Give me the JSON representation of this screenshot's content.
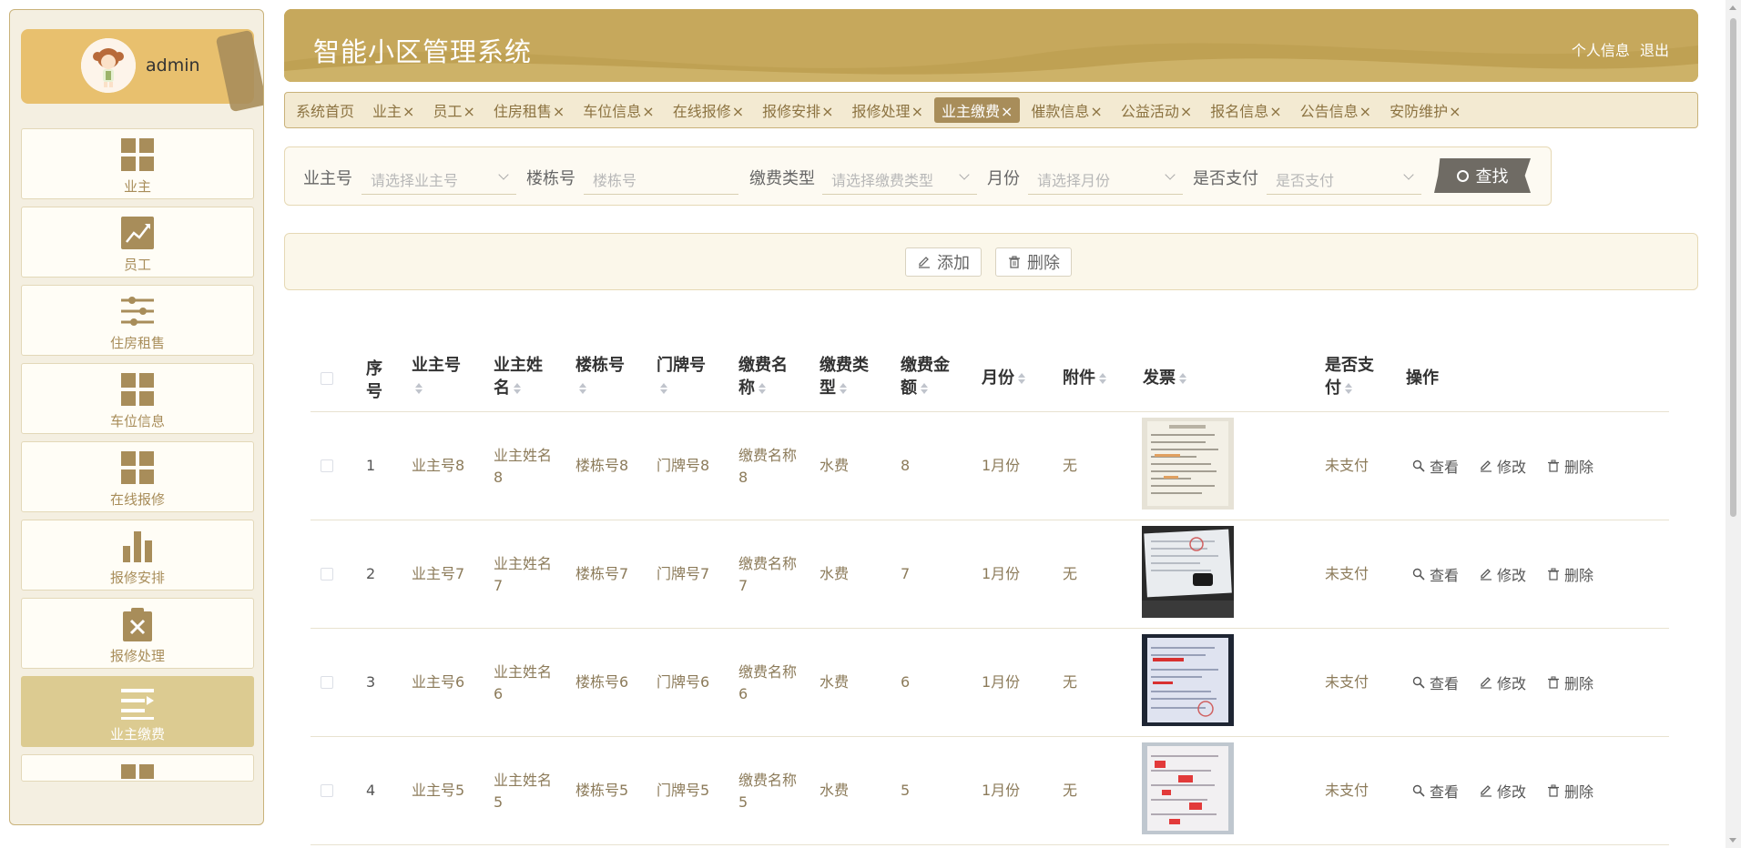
{
  "user": {
    "name": "admin"
  },
  "sidebar": {
    "items": [
      {
        "label": "业主",
        "icon": "grid-icon"
      },
      {
        "label": "员工",
        "icon": "trend-chart-icon"
      },
      {
        "label": "住房租售",
        "icon": "sliders-icon"
      },
      {
        "label": "车位信息",
        "icon": "grid-icon"
      },
      {
        "label": "在线报修",
        "icon": "grid-icon"
      },
      {
        "label": "报修安排",
        "icon": "bar-chart-icon"
      },
      {
        "label": "报修处理",
        "icon": "clipboard-x-icon"
      },
      {
        "label": "业主缴费",
        "icon": "list-arrow-icon",
        "active": true
      }
    ]
  },
  "header": {
    "title": "智能小区管理系统",
    "profile_link": "个人信息",
    "logout_link": "退出"
  },
  "tabs": [
    {
      "label": "系统首页",
      "closable": false
    },
    {
      "label": "业主",
      "closable": true
    },
    {
      "label": "员工",
      "closable": true
    },
    {
      "label": "住房租售",
      "closable": true
    },
    {
      "label": "车位信息",
      "closable": true
    },
    {
      "label": "在线报修",
      "closable": true
    },
    {
      "label": "报修安排",
      "closable": true
    },
    {
      "label": "报修处理",
      "closable": true
    },
    {
      "label": "业主缴费",
      "closable": true,
      "active": true
    },
    {
      "label": "催款信息",
      "closable": true
    },
    {
      "label": "公益活动",
      "closable": true
    },
    {
      "label": "报名信息",
      "closable": true
    },
    {
      "label": "公告信息",
      "closable": true
    },
    {
      "label": "安防维护",
      "closable": true
    }
  ],
  "tab_close_glyph": "×",
  "search": {
    "owner_no_label": "业主号",
    "owner_no_placeholder": "请选择业主号",
    "building_label": "楼栋号",
    "building_placeholder": "楼栋号",
    "fee_type_label": "缴费类型",
    "fee_type_placeholder": "请选择缴费类型",
    "month_label": "月份",
    "month_placeholder": "请选择月份",
    "paid_label": "是否支付",
    "paid_placeholder": "是否支付",
    "search_button": "查找"
  },
  "actions": {
    "add": "添加",
    "delete": "删除"
  },
  "table": {
    "headers": {
      "index": "序号",
      "owner_no": "业主号",
      "owner_name": "业主姓名",
      "building": "楼栋号",
      "door": "门牌号",
      "fee_name": "缴费名称",
      "fee_type": "缴费类型",
      "amount": "缴费金额",
      "month": "月份",
      "attachment": "附件",
      "invoice": "发票",
      "paid": "是否支付",
      "ops": "操作"
    },
    "rows": [
      {
        "index": "1",
        "owner_no": "业主号8",
        "owner_name": "业主姓名8",
        "building": "楼栋号8",
        "door": "门牌号8",
        "fee_name": "缴费名称8",
        "fee_type": "水费",
        "amount": "8",
        "month": "1月份",
        "attachment": "无",
        "paid": "未支付"
      },
      {
        "index": "2",
        "owner_no": "业主号7",
        "owner_name": "业主姓名7",
        "building": "楼栋号7",
        "door": "门牌号7",
        "fee_name": "缴费名称7",
        "fee_type": "水费",
        "amount": "7",
        "month": "1月份",
        "attachment": "无",
        "paid": "未支付"
      },
      {
        "index": "3",
        "owner_no": "业主号6",
        "owner_name": "业主姓名6",
        "building": "楼栋号6",
        "door": "门牌号6",
        "fee_name": "缴费名称6",
        "fee_type": "水费",
        "amount": "6",
        "month": "1月份",
        "attachment": "无",
        "paid": "未支付"
      },
      {
        "index": "4",
        "owner_no": "业主号5",
        "owner_name": "业主姓名5",
        "building": "楼栋号5",
        "door": "门牌号5",
        "fee_name": "缴费名称5",
        "fee_type": "水费",
        "amount": "5",
        "month": "1月份",
        "attachment": "无",
        "paid": "未支付"
      }
    ],
    "row_ops": {
      "view": "查看",
      "edit": "修改",
      "delete": "删除"
    }
  },
  "colors": {
    "brand_gold": "#c6a85c",
    "active_tab": "#a88d5a",
    "active_menu": "#dccb91",
    "search_button": "#6f6b64"
  }
}
